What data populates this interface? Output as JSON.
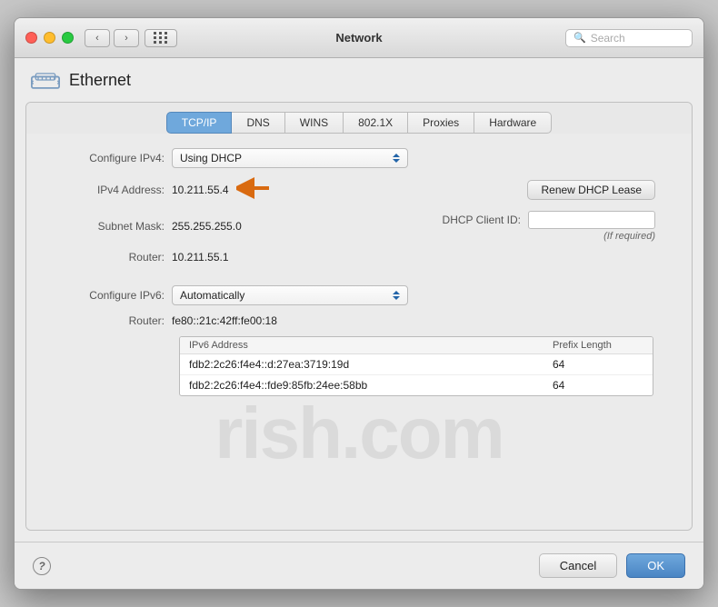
{
  "window": {
    "title": "Network",
    "search_placeholder": "Search"
  },
  "ethernet": {
    "label": "Ethernet"
  },
  "tabs": [
    {
      "id": "tcpip",
      "label": "TCP/IP",
      "active": true
    },
    {
      "id": "dns",
      "label": "DNS",
      "active": false
    },
    {
      "id": "wins",
      "label": "WINS",
      "active": false
    },
    {
      "id": "8021x",
      "label": "802.1X",
      "active": false
    },
    {
      "id": "proxies",
      "label": "Proxies",
      "active": false
    },
    {
      "id": "hardware",
      "label": "Hardware",
      "active": false
    }
  ],
  "form": {
    "configure_ipv4_label": "Configure IPv4:",
    "configure_ipv4_value": "Using DHCP",
    "ipv4_address_label": "IPv4 Address:",
    "ipv4_address_value": "10.211.55.4",
    "subnet_mask_label": "Subnet Mask:",
    "subnet_mask_value": "255.255.255.0",
    "router_label": "Router:",
    "router_value": "10.211.55.1",
    "dhcp_client_label": "DHCP Client ID:",
    "dhcp_client_placeholder": "",
    "if_required": "(If required)",
    "renew_lease_label": "Renew DHCP Lease",
    "configure_ipv6_label": "Configure IPv6:",
    "configure_ipv6_value": "Automatically",
    "router_ipv6_label": "Router:",
    "router_ipv6_value": "fe80::21c:42ff:fe00:18",
    "ipv6_table": {
      "col_address": "IPv6 Address",
      "col_prefix": "Prefix Length",
      "rows": [
        {
          "address": "fdb2:2c26:f4e4::d:27ea:3719:19d",
          "prefix": "64"
        },
        {
          "address": "fdb2:2c26:f4e4::fde9:85fb:24ee:58bb",
          "prefix": "64"
        }
      ]
    }
  },
  "bottom": {
    "cancel_label": "Cancel",
    "ok_label": "OK",
    "help_label": "?"
  }
}
